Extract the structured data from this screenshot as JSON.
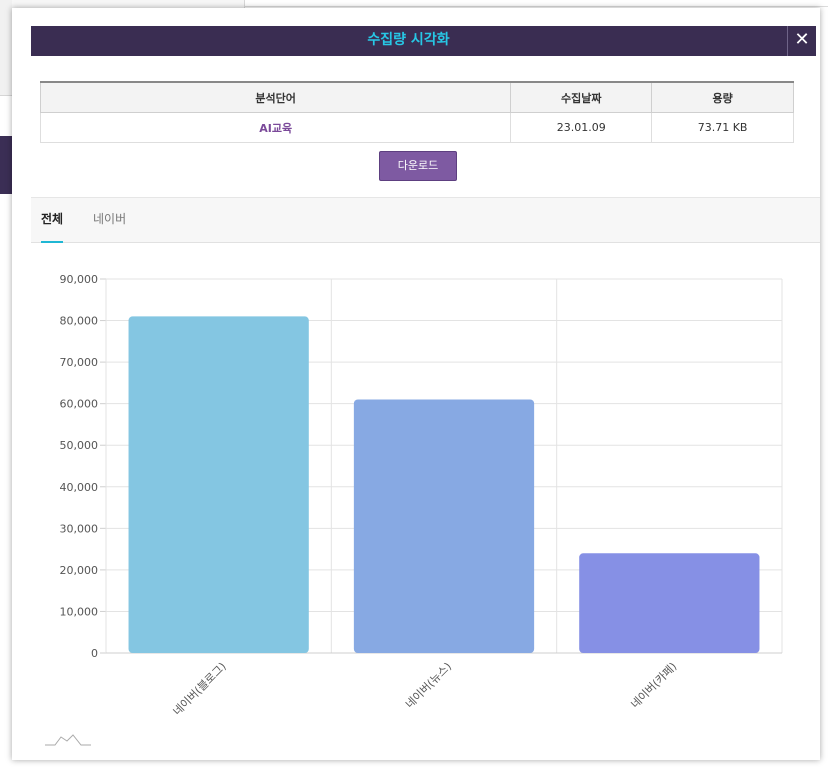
{
  "modal": {
    "title": "수집량 시각화",
    "close_label": "✕"
  },
  "info_table": {
    "headers": [
      "분석단어",
      "수집날짜",
      "용량"
    ],
    "rows": [
      [
        "AI교육",
        "23.01.09",
        "73.71 KB"
      ]
    ]
  },
  "download_label": "다운로드",
  "tabs": [
    {
      "label": "전체",
      "active": true
    },
    {
      "label": "네이버",
      "active": false
    }
  ],
  "colors": {
    "header_bg": "#3a2d52",
    "title": "#27c8e6",
    "accent_tab": "#1fb7d4",
    "button": "#7e5aa2"
  },
  "chart_data": {
    "type": "bar",
    "categories": [
      "네이버(블로그)",
      "네이버(뉴스)",
      "네이버(카페)"
    ],
    "values": [
      81000,
      61000,
      24000
    ],
    "colors": [
      "#84c6e2",
      "#87a9e3",
      "#8690e5"
    ],
    "ylim": [
      0,
      90000
    ],
    "yticks": [
      "0",
      "10,000",
      "20,000",
      "30,000",
      "40,000",
      "50,000",
      "60,000",
      "70,000",
      "80,000",
      "90,000"
    ],
    "grid": true
  }
}
